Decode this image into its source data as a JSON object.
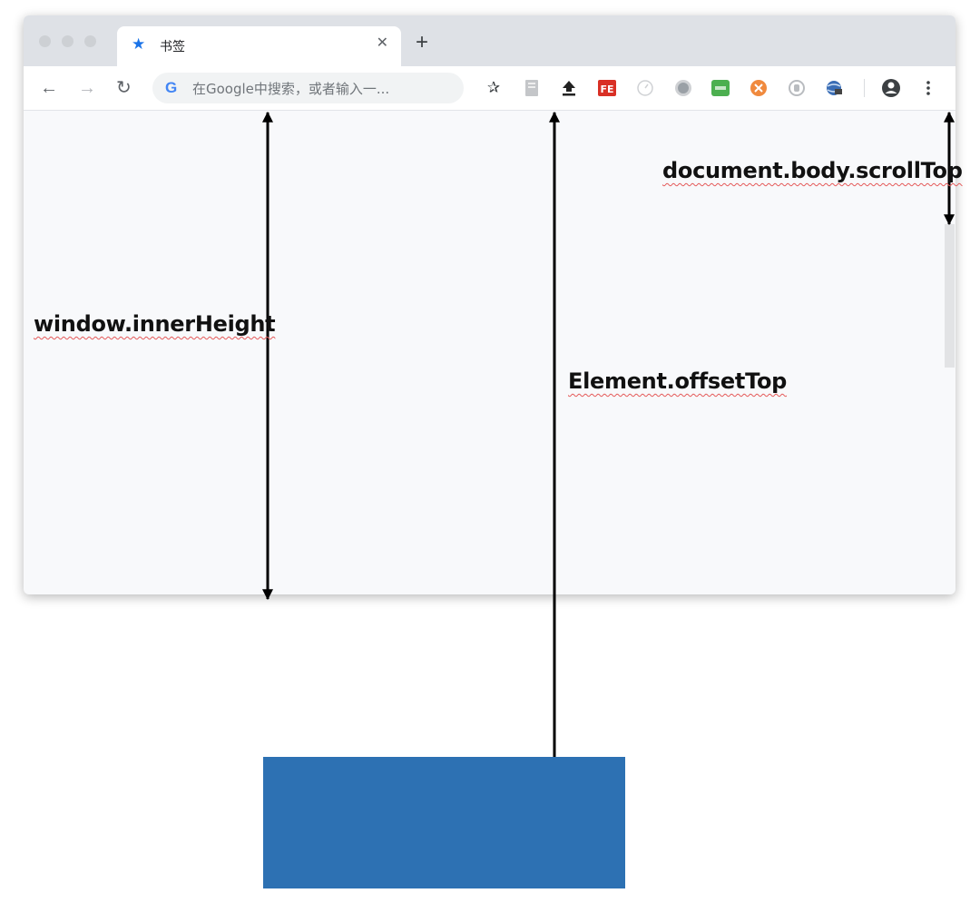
{
  "browser": {
    "tab": {
      "title": "书签",
      "star_icon": "star-icon",
      "close_icon": "close-icon"
    },
    "new_tab_icon": "plus-icon",
    "toolbar": {
      "back_icon": "arrow-left-icon",
      "forward_icon": "arrow-right-icon",
      "reload_icon": "reload-icon",
      "omnibox_logo": "G",
      "omnibox_placeholder": "在Google中搜索，或者输入一...",
      "extension_icons": [
        "pin-icon",
        "reader-icon",
        "upload-icon",
        "fe-extension-icon",
        "clock-icon",
        "gray-circle-icon",
        "green-extension-icon",
        "orange-extension-icon",
        "hand-icon",
        "globe-icon"
      ],
      "profile_icon": "profile-icon",
      "menu_icon": "more-vertical-icon"
    }
  },
  "diagram": {
    "labels": {
      "window_inner_height": "window.innerHeight",
      "element_offset_top": "Element.offsetTop",
      "document_body_scroll_top": "document.body.scrollTop"
    },
    "colors": {
      "element_box": "#2d71b3",
      "arrow": "#000000",
      "spellcheck_underline": "#e45858"
    }
  }
}
